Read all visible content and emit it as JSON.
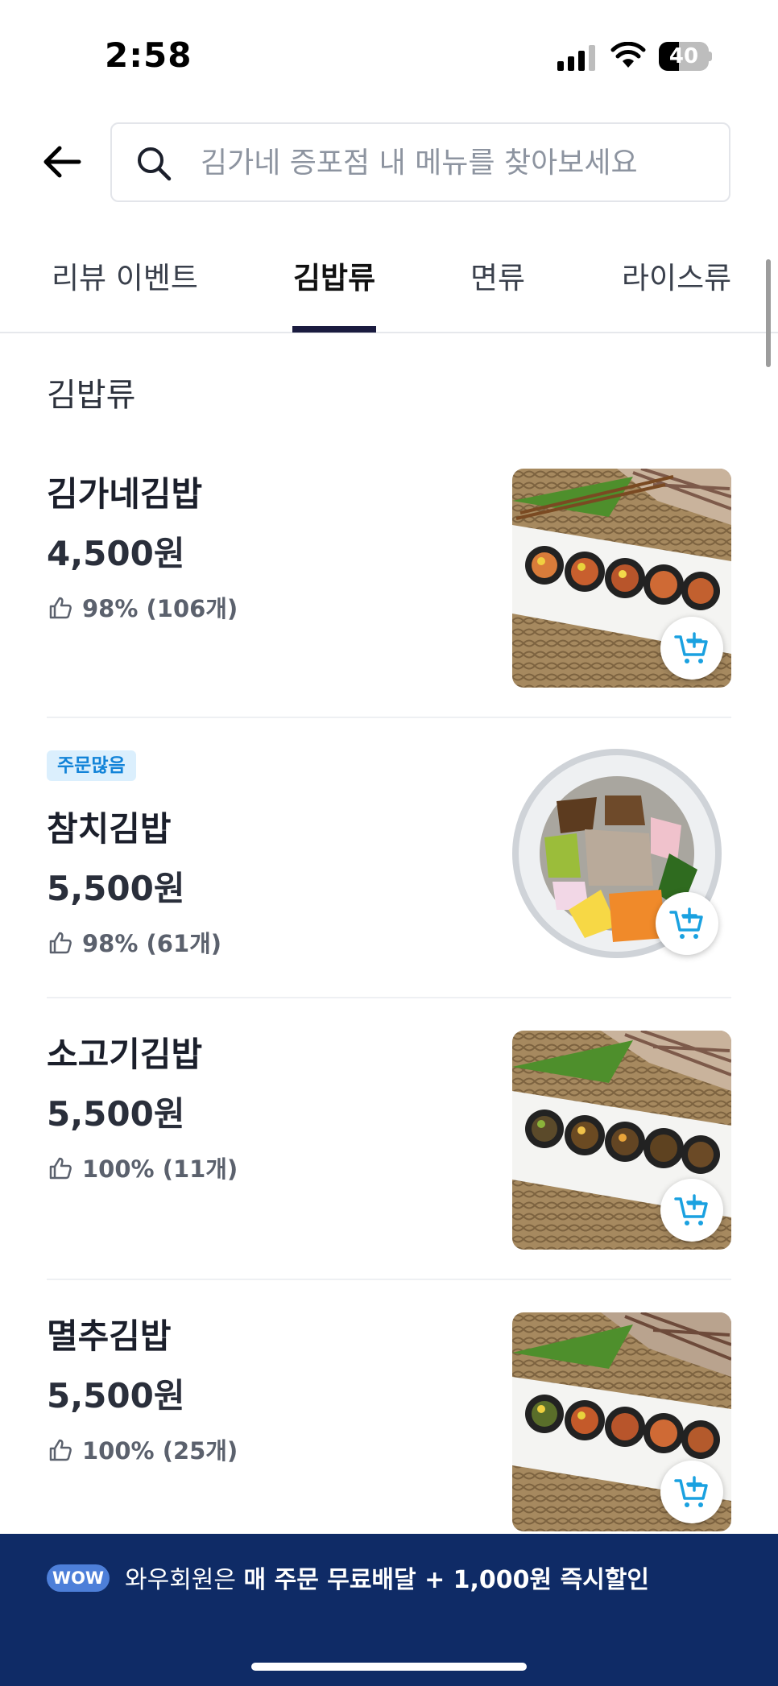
{
  "status_bar": {
    "time": "2:58",
    "battery_level": "40",
    "battery_fraction": 0.4
  },
  "search": {
    "placeholder": "김가네 증포점 내 메뉴를 찾아보세요",
    "value": ""
  },
  "tabs": [
    {
      "label": "리뷰 이벤트",
      "active": false
    },
    {
      "label": "김밥류",
      "active": true
    },
    {
      "label": "면류",
      "active": false
    },
    {
      "label": "라이스류",
      "active": false
    }
  ],
  "section": {
    "title": "김밥류"
  },
  "items": [
    {
      "name": "김가네김밥",
      "price": "4,500원",
      "rating": "98% (106개)",
      "badge": "",
      "image": "gimbap-platter"
    },
    {
      "name": "참치김밥",
      "price": "5,500원",
      "rating": "98% (61개)",
      "badge": "주문많음",
      "image": "gimbap-closeup"
    },
    {
      "name": "소고기김밥",
      "price": "5,500원",
      "rating": "100% (11개)",
      "badge": "",
      "image": "gimbap-platter"
    },
    {
      "name": "멸추김밥",
      "price": "5,500원",
      "rating": "100% (25개)",
      "badge": "",
      "image": "gimbap-platter"
    }
  ],
  "banner": {
    "badge": "WOW",
    "text_prefix": "와우회원은",
    "text_bold": "매 주문 무료배달 + 1,000원 즉시할인"
  },
  "colors": {
    "accent": "#1a1b3f",
    "badge_text": "#1283d8",
    "badge_bg": "#dbeffd",
    "cart_icon": "#1aa1e0",
    "banner_bg": "#0f2b66",
    "wow_badge": "#4d7fd9"
  }
}
